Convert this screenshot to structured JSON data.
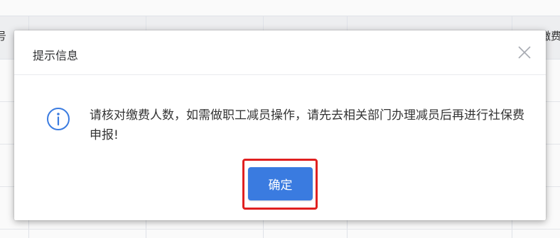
{
  "table": {
    "header_left_partial": "号",
    "header_right_partial": "缴费"
  },
  "dialog": {
    "title": "提示信息",
    "close_icon": "close-icon",
    "info_icon": "info-circle-icon",
    "message": "请核对缴费人数，如需做职工减员操作，请先去相关部门办理减员后再进行社保费申报!",
    "confirm_label": "确定",
    "accent_color": "#3a7be0",
    "highlight_color": "#e02020"
  }
}
